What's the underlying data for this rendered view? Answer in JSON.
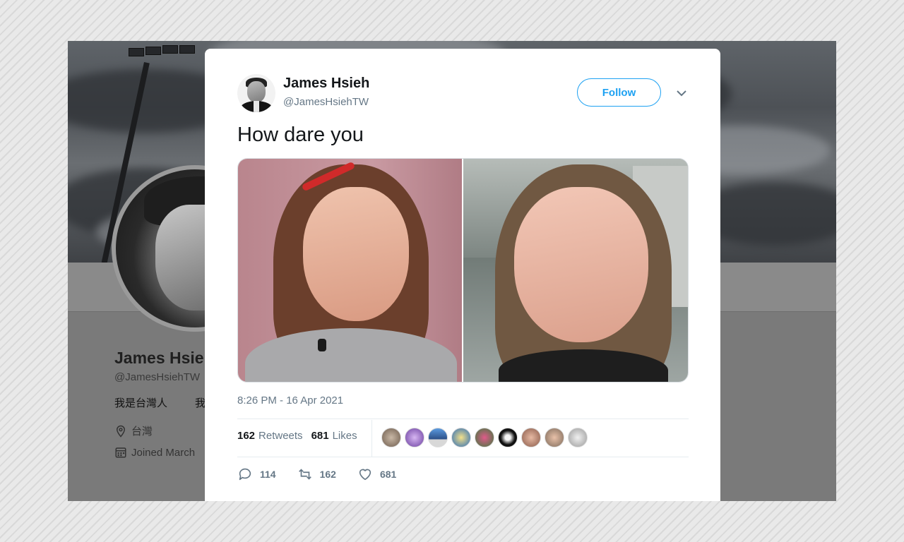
{
  "background_profile": {
    "name": "James Hsie",
    "handle": "@JamesHsiehTW",
    "bio": "我是台灣人",
    "bio_continued": "我",
    "location": "台灣",
    "joined": "Joined March"
  },
  "tweet": {
    "author": {
      "display_name": "James Hsieh",
      "handle": "@JamesHsiehTW"
    },
    "follow_label": "Follow",
    "text": "How dare you",
    "timestamp": "8:26 PM - 16 Apr 2021",
    "stats": {
      "retweets_count": "162",
      "retweets_label": "Retweets",
      "likes_count": "681",
      "likes_label": "Likes"
    },
    "actions": {
      "reply_count": "114",
      "retweet_count": "162",
      "like_count": "681"
    }
  },
  "icons": {
    "reply": "reply-icon",
    "retweet": "retweet-icon",
    "like": "heart-icon",
    "menu": "chevron-down-icon",
    "location": "location-pin-icon",
    "calendar": "calendar-icon"
  },
  "colors": {
    "accent": "#1da1f2",
    "text_primary": "#14171a",
    "text_secondary": "#657786"
  }
}
